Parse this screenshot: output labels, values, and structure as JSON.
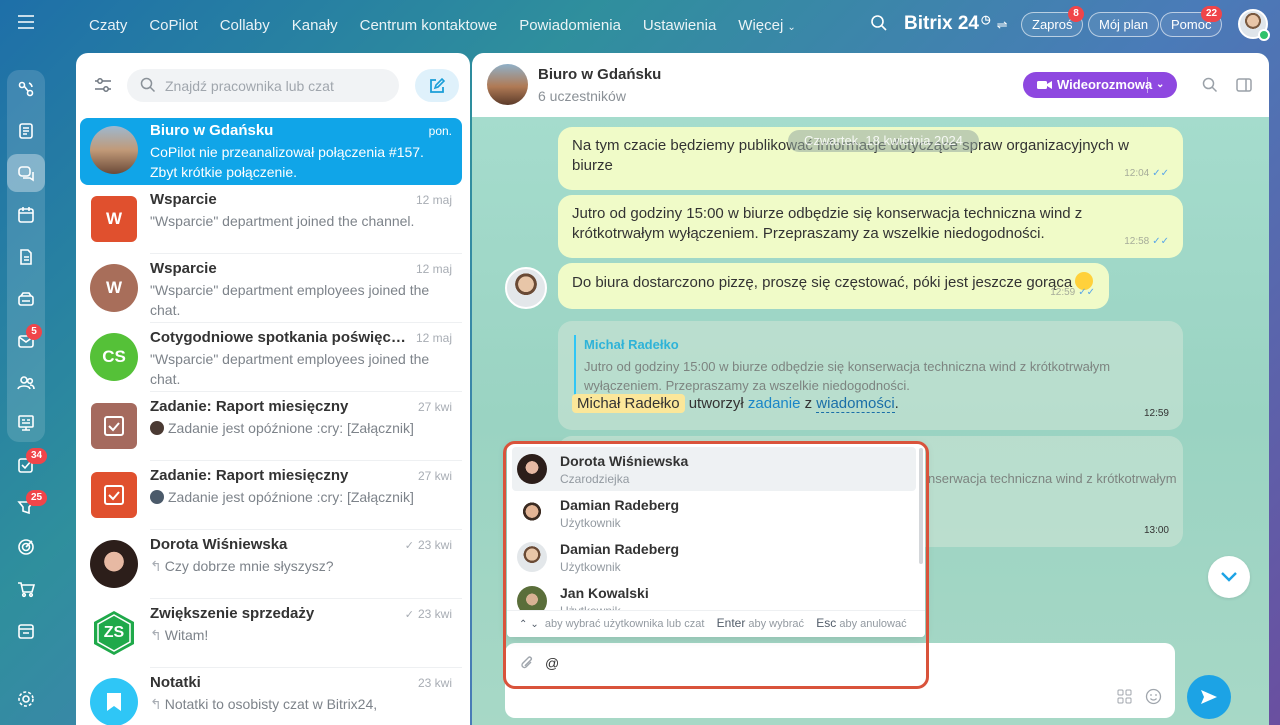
{
  "nav": {
    "items": [
      "Czaty",
      "CoPilot",
      "Collaby",
      "Kanały",
      "Centrum kontaktowe",
      "Powiadomienia",
      "Ustawienia",
      "Więcej"
    ],
    "brand": "Bitrix",
    "brand_num": "24",
    "invite_label": "Zaproś",
    "invite_badge": "8",
    "plan_label": "Mój plan",
    "help_label": "Pomoc",
    "help_badge": "22"
  },
  "rail": {
    "badges": {
      "mail": "5",
      "tasks": "34",
      "feed": "25"
    }
  },
  "list": {
    "search_placeholder": "Znajdź pracownika lub czat",
    "chats": [
      {
        "title": "Biuro w Gdańsku",
        "date": "pon.",
        "msg": "CoPilot nie przeanalizował połączenia #157. Zbyt krótkie połączenie.",
        "avatar_text": "",
        "color": "#8a6a52"
      },
      {
        "title": "Wsparcie",
        "date": "12 maj",
        "msg": "\"Wsparcie\" department joined the channel.",
        "avatar_text": "W",
        "color": "#e0502e"
      },
      {
        "title": "Wsparcie",
        "date": "12 maj",
        "msg": "\"Wsparcie\" department employees joined the chat.",
        "avatar_text": "W",
        "color": "#a86e5a"
      },
      {
        "title": "Cotygodniowe spotkania poświęcon...",
        "date": "12 maj",
        "msg": "\"Wsparcie\" department employees joined the chat.",
        "avatar_text": "CS",
        "color": "#55c138"
      },
      {
        "title": "Zadanie: Raport miesięczny",
        "date": "27 kwi",
        "msg": "Zadanie jest opóźnione :cry: [Załącznik]",
        "avatar_text": "",
        "color": "#a56a5e"
      },
      {
        "title": "Zadanie: Raport miesięczny",
        "date": "27 kwi",
        "msg": "Zadanie jest opóźnione :cry: [Załącznik]",
        "avatar_text": "",
        "color": "#e0502e"
      },
      {
        "title": "Dorota Wiśniewska",
        "date": "23 kwi",
        "msg": "Czy dobrze mnie słyszysz?",
        "avatar_text": "",
        "color": "#3a2a26"
      },
      {
        "title": "Zwiększenie sprzedaży",
        "date": "23 kwi",
        "msg": "Witam!",
        "avatar_text": "ZS",
        "color": "#1fa94a"
      },
      {
        "title": "Notatki",
        "date": "23 kwi",
        "msg": "Notatki to osobisty czat w Bitrix24,",
        "avatar_text": "",
        "color": "#2fc6f6"
      }
    ]
  },
  "chat": {
    "title": "Biuro w Gdańsku",
    "subtitle": "6 uczestników",
    "video_label": "Wideorozmowa",
    "date_pill": "Czwartek, 18 kwietnia 2024",
    "messages": [
      {
        "text": "Na tym czacie będziemy publikować informacje dotyczące spraw organizacyjnych w biurze",
        "time": "12:04"
      },
      {
        "text": "Jutro od godziny 15:00 w biurze odbędzie się konserwacja techniczna wind z krótkotrwałym wyłączeniem. Przepraszamy za wszelkie niedogodności.",
        "time": "12:58"
      },
      {
        "text": "Do biura dostarczono pizzę, proszę się częstować, póki jest jeszcze gorąca",
        "time": "12:59"
      }
    ],
    "system": {
      "quote_author": "Michał Radełko",
      "quote_text": "Jutro od godziny 15:00 w biurze odbędzie się konserwacja techniczna wind z krótkotrwałym wyłączeniem. Przepraszamy za wszelkie niedogodności.",
      "mention": "Michał Radełko",
      "verb": "utworzył",
      "link1": "zadanie",
      "conj": "z",
      "link2": "wiadomości",
      "period": ".",
      "time": "12:59"
    },
    "partial": {
      "text": "nserwacja techniczna wind z krótkotrwałym",
      "time": "13:00"
    },
    "input_value": "@"
  },
  "mention_popup": {
    "users": [
      {
        "name": "Dorota Wiśniewska",
        "role": "Czarodziejka"
      },
      {
        "name": "Damian Radeberg",
        "role": "Użytkownik"
      },
      {
        "name": "Damian Radeberg",
        "role": "Użytkownik"
      },
      {
        "name": "Jan Kowalski",
        "role": "Użytkownik"
      }
    ],
    "hint_select": "aby wybrać użytkownika lub czat",
    "enter_key": "Enter",
    "enter_hint": "aby wybrać",
    "esc_key": "Esc",
    "esc_hint": "aby anulować"
  }
}
